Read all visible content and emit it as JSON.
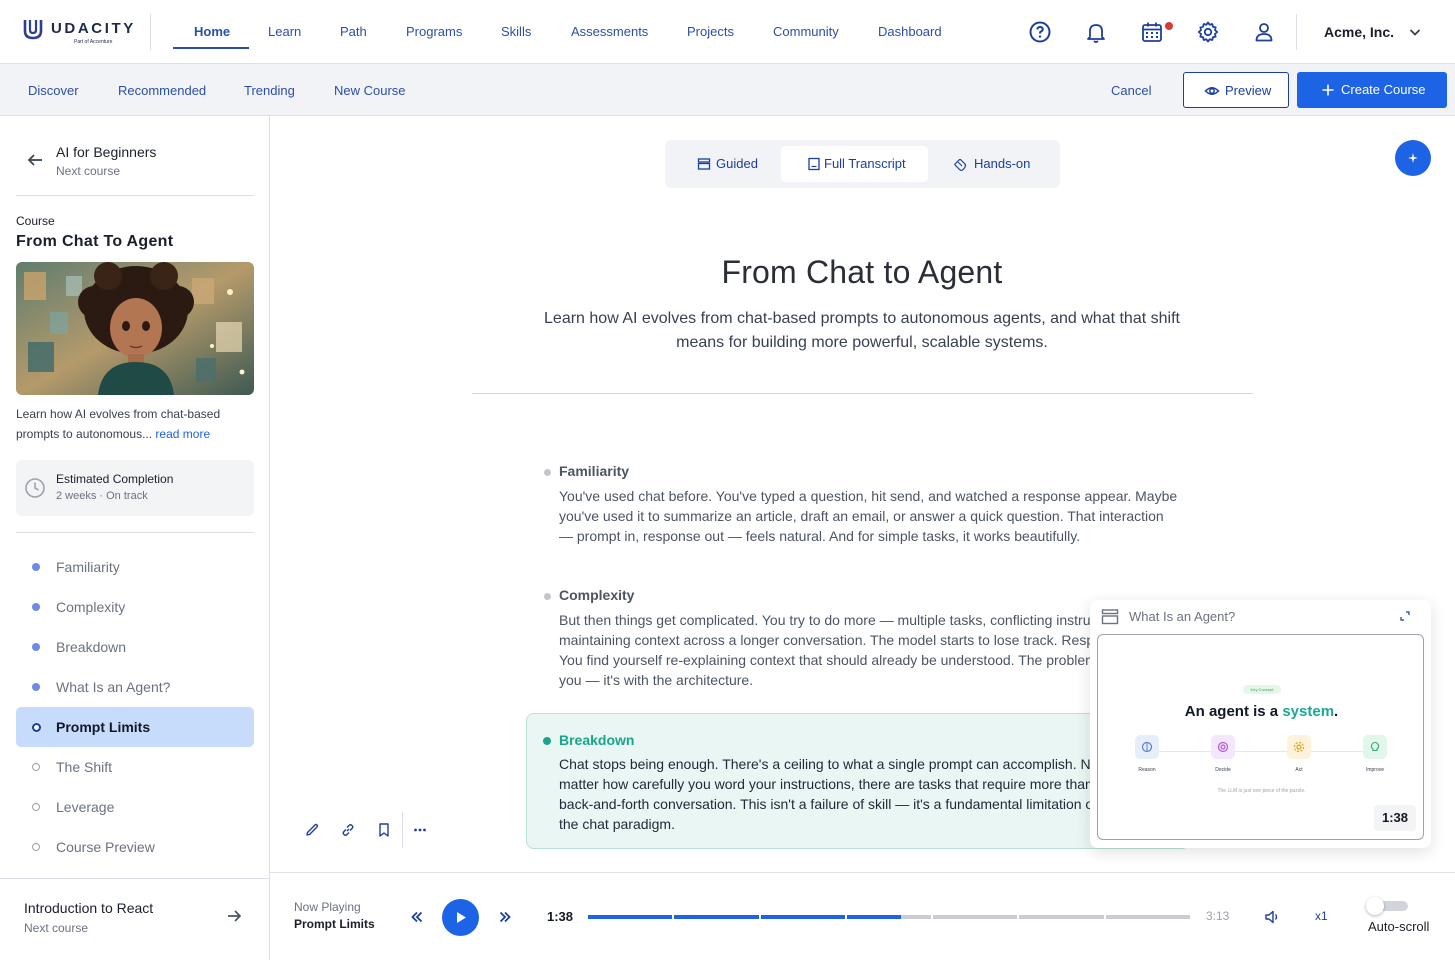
{
  "brand": {
    "name": "UDACITY",
    "sub": "Part of Accenture"
  },
  "nav": {
    "items": [
      "Home",
      "Learn",
      "Path",
      "Programs",
      "Skills",
      "Assessments",
      "Projects",
      "Community",
      "Dashboard"
    ],
    "active": "Home"
  },
  "account": {
    "org": "Acme, Inc."
  },
  "subnav": {
    "items": [
      "Discover",
      "Recommended",
      "Trending",
      "New Course"
    ],
    "cancel": "Cancel",
    "preview": "Preview",
    "create": "Create Course"
  },
  "sidebar": {
    "previous": {
      "title": "AI for Beginners",
      "sub": "Next course"
    },
    "course_label": "Course",
    "course_title": "From Chat To Agent",
    "description": "Learn how AI evolves from chat-based prompts to autonomous...",
    "read_more": "read more",
    "estimate": {
      "title": "Estimated Completion",
      "sub": "2 weeks · On track"
    },
    "lessons": [
      {
        "name": "Familiarity",
        "status": "done"
      },
      {
        "name": "Complexity",
        "status": "done"
      },
      {
        "name": "Breakdown",
        "status": "done"
      },
      {
        "name": "What Is an Agent?",
        "status": "done"
      },
      {
        "name": "Prompt Limits",
        "status": "current"
      },
      {
        "name": "The Shift",
        "status": "todo"
      },
      {
        "name": "Leverage",
        "status": "todo"
      },
      {
        "name": "Course Preview",
        "status": "todo"
      }
    ],
    "next": {
      "title": "Introduction to React",
      "sub": "Next course"
    }
  },
  "view_tabs": {
    "items": [
      "Guided",
      "Full Transcript",
      "Hands-on"
    ],
    "active": "Full Transcript"
  },
  "main": {
    "title": "From Chat to Agent",
    "subtitle": "Learn how AI evolves from chat-based prompts to autonomous agents, and what that shift means for building more powerful, scalable systems.",
    "sections": [
      {
        "heading": "Familiarity",
        "body": "You've used chat before. You've typed a question, hit send, and watched a response appear. Maybe you've used it to summarize an article, draft an email, or answer a quick question. That interaction — prompt in, response out — feels natural. And for simple tasks, it works beautifully."
      },
      {
        "heading": "Complexity",
        "body": "But then things get complicated. You try to do more — multiple tasks, conflicting instructions, maintaining context across a longer conversation. The model starts to lose track. Responses drift. You find yourself re-explaining context that should already be understood. The problem isn't with you — it's with the architecture."
      },
      {
        "heading": "Breakdown",
        "body": "Chat stops being enough. There's a ceiling to what a single prompt can accomplish. No matter how carefully you word your instructions, there are tasks that require more than a back-and-forth conversation. This isn't a failure of skill — it's a fundamental limitation of the chat paradigm."
      }
    ]
  },
  "popup": {
    "title": "What Is an Agent?",
    "badge": "Key Concept",
    "headline_a": "An agent is a ",
    "headline_b": "system",
    "headline_c": ".",
    "steps": [
      "Reason",
      "Decide",
      "Act",
      "Improve"
    ],
    "caption": "The LLM is just one piece of the puzzle.",
    "time": "1:38"
  },
  "player": {
    "now_playing_label": "Now Playing",
    "now_playing_title": "Prompt Limits",
    "current_time": "1:38",
    "total_time": "3:13",
    "speed": "x1",
    "autoscroll_label": "Auto-scroll",
    "progress": 0.52,
    "segments": 7
  },
  "colors": {
    "accent": "#1c63e6",
    "nav": "#2b4fa8",
    "highlight_bg": "#e9f6f3",
    "highlight_text": "#1aa58a"
  }
}
